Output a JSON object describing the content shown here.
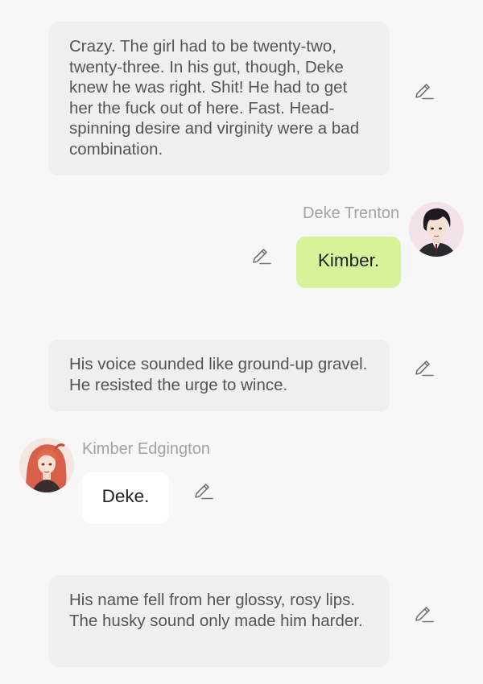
{
  "messages": [
    {
      "kind": "narration",
      "text": "Crazy. The girl had to be twenty-two, twenty-three. In his gut, though, Deke knew he was right. Shit! He had to get her the fuck out of here. Fast. Head-spinning desire and virginity were a bad combination.",
      "edit_icon": "pencil-icon"
    },
    {
      "kind": "user",
      "speaker": "Deke Trenton",
      "text": "Kimber.",
      "bubble_color": "#d6f39a",
      "edit_icon": "pencil-icon"
    },
    {
      "kind": "narration",
      "text": "His voice sounded like ground-up gravel. He resisted the urge to wince.",
      "edit_icon": "pencil-icon"
    },
    {
      "kind": "character",
      "speaker": "Kimber Edgington",
      "text": "Deke.",
      "bubble_color": "#ffffff",
      "edit_icon": "pencil-icon"
    },
    {
      "kind": "narration",
      "text": "His name fell from her glossy, rosy lips. The husky sound only made him harder.",
      "edit_icon": "pencil-icon"
    }
  ],
  "colors": {
    "background": "#f7f7f7",
    "narration_bubble": "#efefef",
    "narration_text": "#555555",
    "speaker_name": "#a3a3a3",
    "icon": "#777777"
  }
}
